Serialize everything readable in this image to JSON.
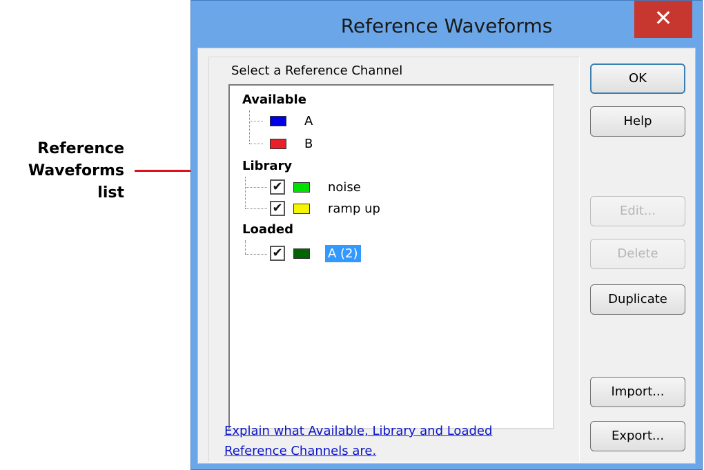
{
  "callout": {
    "lines": [
      "Reference",
      "Waveforms",
      "list"
    ]
  },
  "window": {
    "title": "Reference Waveforms",
    "close_label": "✕"
  },
  "group": {
    "label": "Select a Reference Channel"
  },
  "tree": {
    "available": {
      "header": "Available",
      "items": [
        {
          "label": "A",
          "color": "#0000e6"
        },
        {
          "label": "B",
          "color": "#e8202a"
        }
      ]
    },
    "library": {
      "header": "Library",
      "items": [
        {
          "label": "noise",
          "color": "#00e000",
          "checked": true
        },
        {
          "label": "ramp up",
          "color": "#f5f500",
          "checked": true
        }
      ]
    },
    "loaded": {
      "header": "Loaded",
      "items": [
        {
          "label": "A (2)",
          "color": "#006400",
          "checked": true,
          "selected": true
        }
      ]
    }
  },
  "help_link": {
    "line1": "Explain what Available, Library and Loaded",
    "line2": "Reference Channels are."
  },
  "buttons": {
    "ok": "OK",
    "help": "Help",
    "edit": "Edit...",
    "delete": "Delete",
    "duplicate": "Duplicate",
    "import": "Import...",
    "export": "Export..."
  },
  "colors": {
    "accent_frame": "#6aa6e8",
    "close": "#c7372f",
    "selection": "#3399ff",
    "callout": "#e0101a",
    "link": "#0a14c8"
  }
}
